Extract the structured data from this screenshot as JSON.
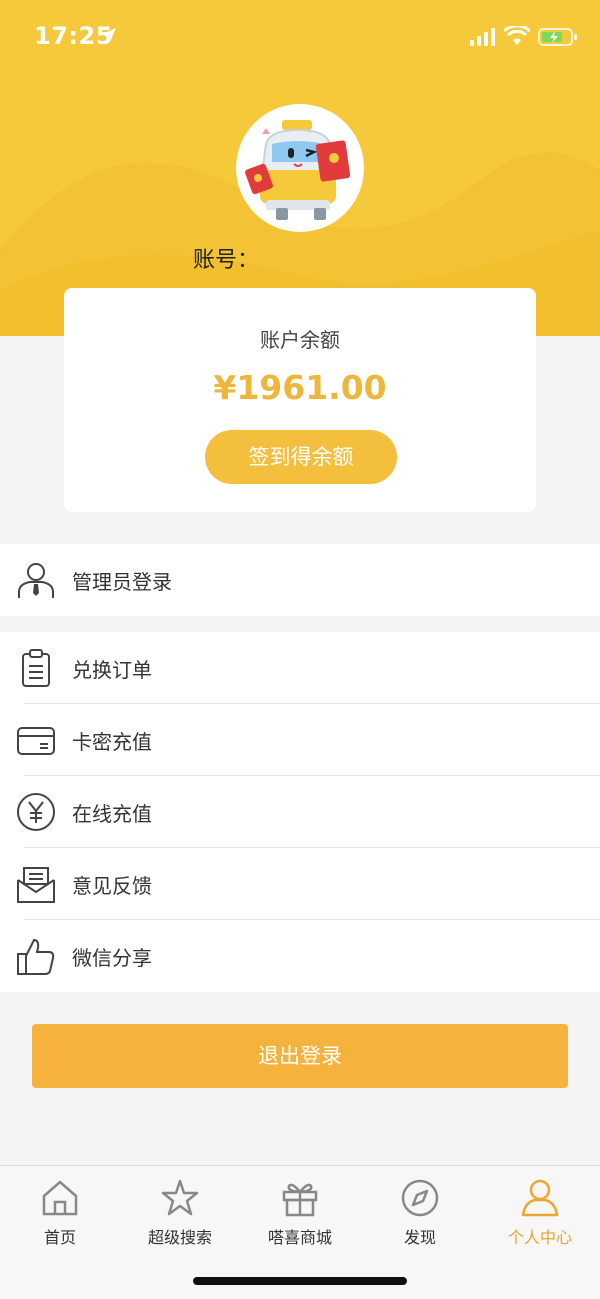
{
  "status_bar": {
    "time": "17:25"
  },
  "account": {
    "label": "账号："
  },
  "balance_card": {
    "title": "账户余额",
    "amount": "¥1961.00",
    "signin_label": "签到得余额"
  },
  "admin_menu": {
    "items": [
      {
        "label": "管理员登录",
        "icon": "user-tie-icon"
      }
    ]
  },
  "main_menu": {
    "items": [
      {
        "label": "兑换订单",
        "icon": "clipboard-icon"
      },
      {
        "label": "卡密充值",
        "icon": "card-icon"
      },
      {
        "label": "在线充值",
        "icon": "yen-icon"
      },
      {
        "label": "意见反馈",
        "icon": "envelope-icon"
      },
      {
        "label": "微信分享",
        "icon": "thumbs-up-icon"
      }
    ]
  },
  "logout": {
    "label": "退出登录"
  },
  "tabbar": {
    "tabs": [
      {
        "label": "首页",
        "icon": "home-icon"
      },
      {
        "label": "超级搜索",
        "icon": "star-icon"
      },
      {
        "label": "嗒喜商城",
        "icon": "gift-icon"
      },
      {
        "label": "发现",
        "icon": "compass-icon"
      },
      {
        "label": "个人中心",
        "icon": "person-icon",
        "active": true
      }
    ]
  },
  "colors": {
    "header": "#f5c93a",
    "accent": "#f5b23c",
    "amount": "#efb63c",
    "active_tab": "#eea62e"
  }
}
